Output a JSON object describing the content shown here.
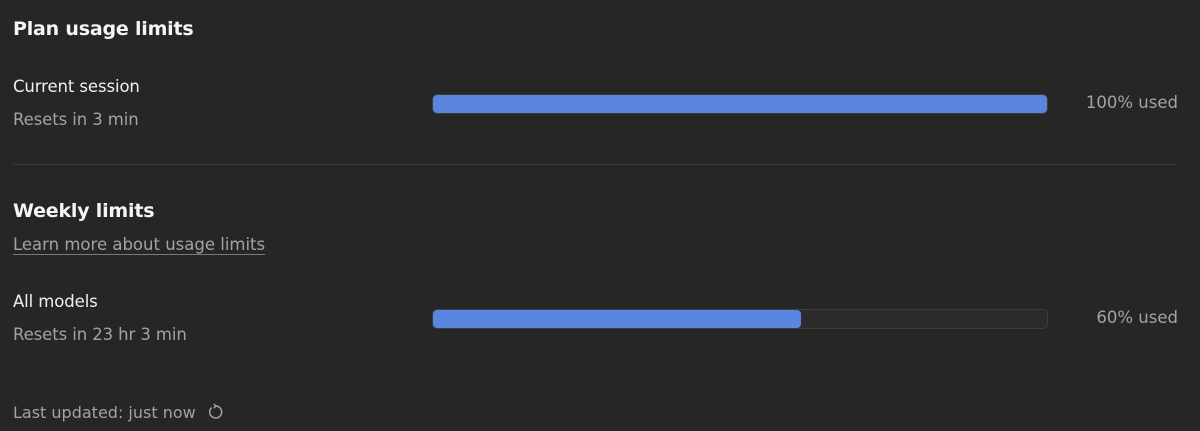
{
  "plan": {
    "title": "Plan usage limits"
  },
  "current_session": {
    "label": "Current session",
    "resets": "Resets in 3 min",
    "usage_fraction": 1.0,
    "usage_text": "100% used"
  },
  "weekly": {
    "title": "Weekly limits",
    "learn_more": "Learn more about usage limits"
  },
  "all_models": {
    "label": "All models",
    "resets": "Resets in 23 hr 3 min",
    "usage_fraction": 0.6,
    "usage_text": "60% used"
  },
  "footer": {
    "last_updated": "Last updated: just now",
    "refresh_icon": "refresh-icon"
  },
  "colors": {
    "bar_fill": "#5b86e0",
    "background": "#262626"
  }
}
